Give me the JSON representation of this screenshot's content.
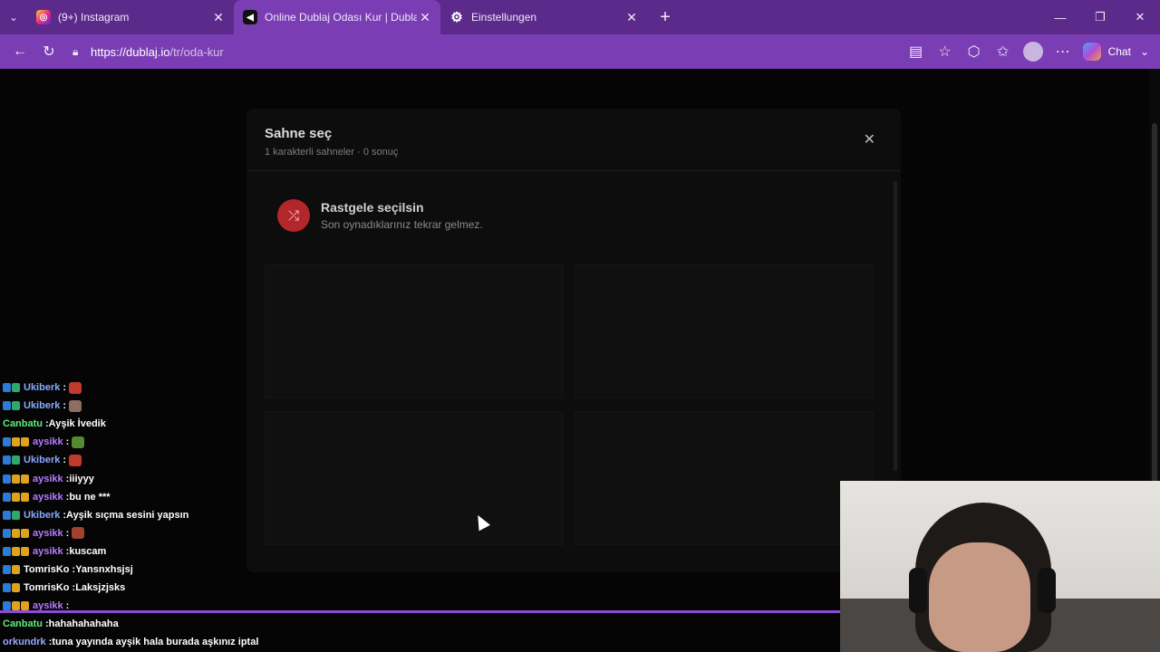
{
  "browser": {
    "tabs": [
      {
        "title": "(9+) Instagram",
        "favicon": "instagram-icon"
      },
      {
        "title": "Online Dublaj Odası Kur | Dublaj.io",
        "favicon": "dublaj-icon"
      },
      {
        "title": "Einstellungen",
        "favicon": "gear-icon"
      }
    ],
    "new_tab": "+",
    "close_glyph": "✕",
    "url_host": "https://dublaj.io",
    "url_path": "/tr/oda-kur",
    "chat_label": "Chat",
    "accent_color": "#7a3db3"
  },
  "modal": {
    "title": "Sahne seç",
    "subtitle": "1 karakterli sahneler · 0 sonuç",
    "close_glyph": "✕",
    "random_title": "Rastgele seçilsin",
    "random_subtitle": "Son oynadıklarınız tekrar gelmez.",
    "random_color": "#b3272b"
  },
  "chat": {
    "messages": [
      {
        "user": "Ukiberk",
        "text": "",
        "color": "#8aa8ff",
        "emote": "#c0392b"
      },
      {
        "user": "Ukiberk",
        "text": "",
        "color": "#8aa8ff",
        "emote": "#8d6e63"
      },
      {
        "user": "Canbatu",
        "text": "Ayşik İvedik",
        "color": "#5cf07a",
        "emote": ""
      },
      {
        "user": "aysikk",
        "text": "",
        "color": "#b57bff",
        "emote": "#558b2f"
      },
      {
        "user": "Ukiberk",
        "text": "",
        "color": "#8aa8ff",
        "emote": "#c0392b"
      },
      {
        "user": "aysikk",
        "text": "iiiyyy",
        "color": "#b57bff",
        "emote": ""
      },
      {
        "user": "aysikk",
        "text": "bu ne ***",
        "color": "#b57bff",
        "emote": ""
      },
      {
        "user": "Ukiberk",
        "text": "Ayşik sıçma sesini yapsın",
        "color": "#8aa8ff",
        "emote": ""
      },
      {
        "user": "aysikk",
        "text": "",
        "color": "#b57bff",
        "emote": "#a1412f"
      },
      {
        "user": "aysikk",
        "text": "kuscam",
        "color": "#b57bff",
        "emote": ""
      },
      {
        "user": "TomrisKo",
        "text": "Yansnxhsjsj",
        "color": "#ffffff",
        "emote": ""
      },
      {
        "user": "TomrisKo",
        "text": "Laksjzjsks",
        "color": "#ffffff",
        "emote": ""
      },
      {
        "user": "aysikk",
        "text": "",
        "color": "#b57bff",
        "emote": ""
      },
      {
        "user": "Canbatu",
        "text": "hahahahahaha",
        "color": "#5cf07a",
        "emote": ""
      },
      {
        "user": "orkundrk",
        "text": "tuna yayında ayşik hala burada aşkınız iptal",
        "color": "#9aa8ff",
        "emote": ""
      }
    ],
    "separator": ":"
  }
}
